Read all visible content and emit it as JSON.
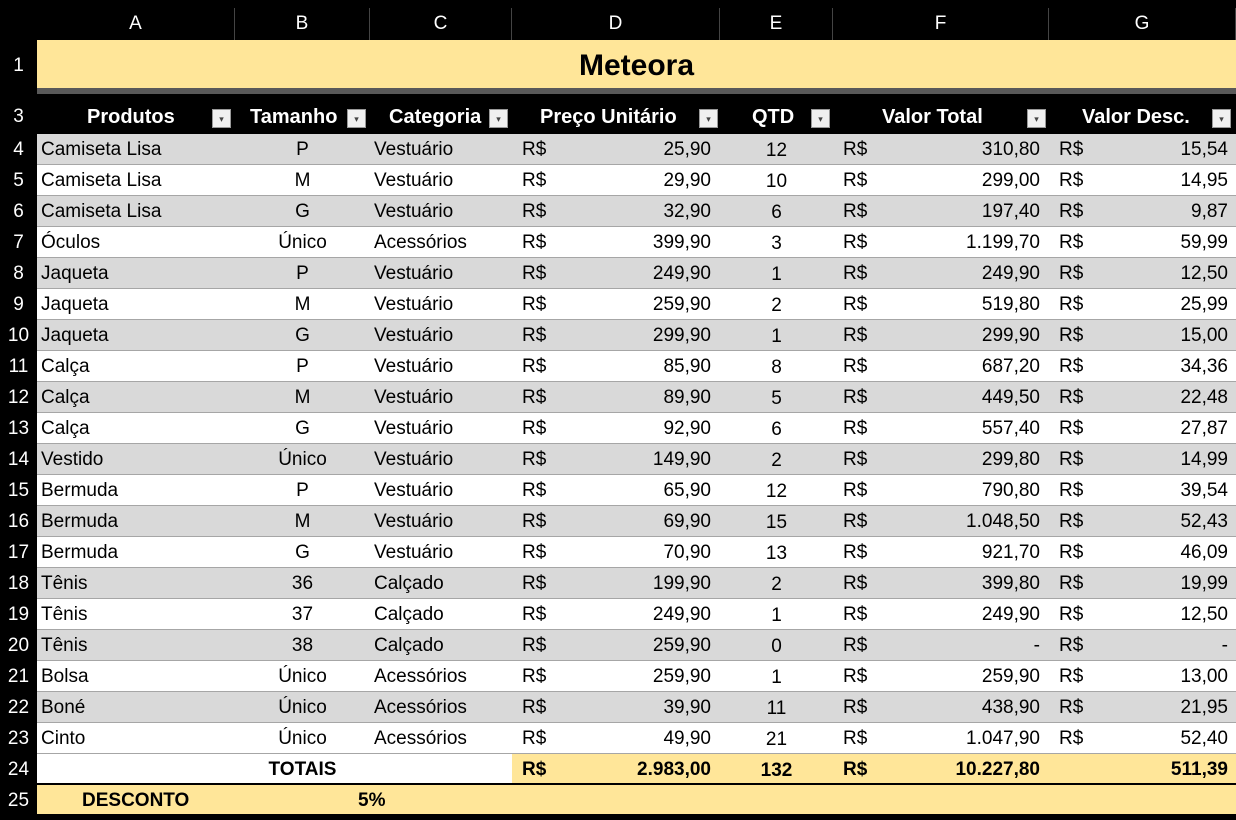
{
  "columns": [
    "A",
    "B",
    "C",
    "D",
    "E",
    "F",
    "G"
  ],
  "title": "Meteora",
  "headers": [
    "Produtos",
    "Tamanho",
    "Categoria",
    "Preço Unitário",
    "QTD",
    "Valor Total",
    "Valor Desc."
  ],
  "currency": "R$",
  "rows": [
    [
      "Camiseta Lisa",
      "P",
      "Vestuário",
      "25,90",
      "12",
      "310,80",
      "15,54"
    ],
    [
      "Camiseta Lisa",
      "M",
      "Vestuário",
      "29,90",
      "10",
      "299,00",
      "14,95"
    ],
    [
      "Camiseta Lisa",
      "G",
      "Vestuário",
      "32,90",
      "6",
      "197,40",
      "9,87"
    ],
    [
      "Óculos",
      "Único",
      "Acessórios",
      "399,90",
      "3",
      "1.199,70",
      "59,99"
    ],
    [
      "Jaqueta",
      "P",
      "Vestuário",
      "249,90",
      "1",
      "249,90",
      "12,50"
    ],
    [
      "Jaqueta",
      "M",
      "Vestuário",
      "259,90",
      "2",
      "519,80",
      "25,99"
    ],
    [
      "Jaqueta",
      "G",
      "Vestuário",
      "299,90",
      "1",
      "299,90",
      "15,00"
    ],
    [
      "Calça",
      "P",
      "Vestuário",
      "85,90",
      "8",
      "687,20",
      "34,36"
    ],
    [
      "Calça",
      "M",
      "Vestuário",
      "89,90",
      "5",
      "449,50",
      "22,48"
    ],
    [
      "Calça",
      "G",
      "Vestuário",
      "92,90",
      "6",
      "557,40",
      "27,87"
    ],
    [
      "Vestido",
      "Único",
      "Vestuário",
      "149,90",
      "2",
      "299,80",
      "14,99"
    ],
    [
      "Bermuda",
      "P",
      "Vestuário",
      "65,90",
      "12",
      "790,80",
      "39,54"
    ],
    [
      "Bermuda",
      "M",
      "Vestuário",
      "69,90",
      "15",
      "1.048,50",
      "52,43"
    ],
    [
      "Bermuda",
      "G",
      "Vestuário",
      "70,90",
      "13",
      "921,70",
      "46,09"
    ],
    [
      "Tênis",
      "36",
      "Calçado",
      "199,90",
      "2",
      "399,80",
      "19,99"
    ],
    [
      "Tênis",
      "37",
      "Calçado",
      "249,90",
      "1",
      "249,90",
      "12,50"
    ],
    [
      "Tênis",
      "38",
      "Calçado",
      "259,90",
      "0",
      "-",
      "-"
    ],
    [
      "Bolsa",
      "Único",
      "Acessórios",
      "259,90",
      "1",
      "259,90",
      "13,00"
    ],
    [
      "Boné",
      "Único",
      "Acessórios",
      "39,90",
      "11",
      "438,90",
      "21,95"
    ],
    [
      "Cinto",
      "Único",
      "Acessórios",
      "49,90",
      "21",
      "1.047,90",
      "52,40"
    ]
  ],
  "totals": {
    "label": "TOTAIS",
    "price": "2.983,00",
    "qty": "132",
    "total": "10.227,80",
    "desc": "511,39"
  },
  "discount": {
    "label": "DESCONTO",
    "value": "5%"
  },
  "row_numbers": [
    "1",
    "3",
    "4",
    "5",
    "6",
    "7",
    "8",
    "9",
    "10",
    "11",
    "12",
    "13",
    "14",
    "15",
    "16",
    "17",
    "18",
    "19",
    "20",
    "21",
    "22",
    "23",
    "24",
    "25"
  ],
  "colors": {
    "title_fill": "#FFE699",
    "band": "#D9D9D9"
  }
}
